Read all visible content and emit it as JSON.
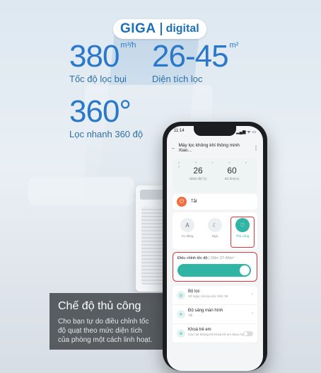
{
  "brand": {
    "giga": "GIGA",
    "digital": "digital"
  },
  "specs": {
    "filter_speed": {
      "value": "380",
      "unit": "m³/h",
      "caption": "Tốc độ lọc bụi"
    },
    "area": {
      "value": "26-45",
      "unit": "m²",
      "caption": "Diện tích lọc"
    },
    "angle": {
      "value": "360°",
      "caption": "Lọc nhanh 360 độ"
    }
  },
  "panel": {
    "title": "Chế độ thủ công",
    "desc": "Cho bạn tự do điều chỉnh tốc độ quạt theo mức diện tích của phòng một cách linh hoạt."
  },
  "phone": {
    "status_time": "11:14",
    "status_icons": "▂▄▆ ᯤ ▭",
    "appbar": {
      "back": "←",
      "title": "Máy lọc không khí thông minh Xiao...",
      "more": "⋮"
    },
    "readings": [
      {
        "value": "26",
        "label": "Nhiệt độ(°C)"
      },
      {
        "value": "60",
        "label": "Độ ẩm(%)"
      }
    ],
    "power": {
      "icon": "⏻",
      "label": "Tắt"
    },
    "modes": [
      {
        "icon": "A",
        "label": "Tự động"
      },
      {
        "icon": "☾",
        "label": "Ngủ"
      },
      {
        "icon": "♡",
        "label": "Thủ công"
      }
    ],
    "speed": {
      "title": "Điều chỉnh tốc độ",
      "sub": "| Diện 37-46m²"
    },
    "list": [
      {
        "icon": "◎",
        "title": "Bộ lọc",
        "sub": "Số ngày còn lại ước tính: 99"
      },
      {
        "icon": "☀",
        "title": "Độ sáng màn hình",
        "sub": "Tắt"
      },
      {
        "icon": "⊖",
        "title": "Khoá trẻ em",
        "sub": "Các nút không khi khoá trẻ em được bật"
      }
    ]
  }
}
